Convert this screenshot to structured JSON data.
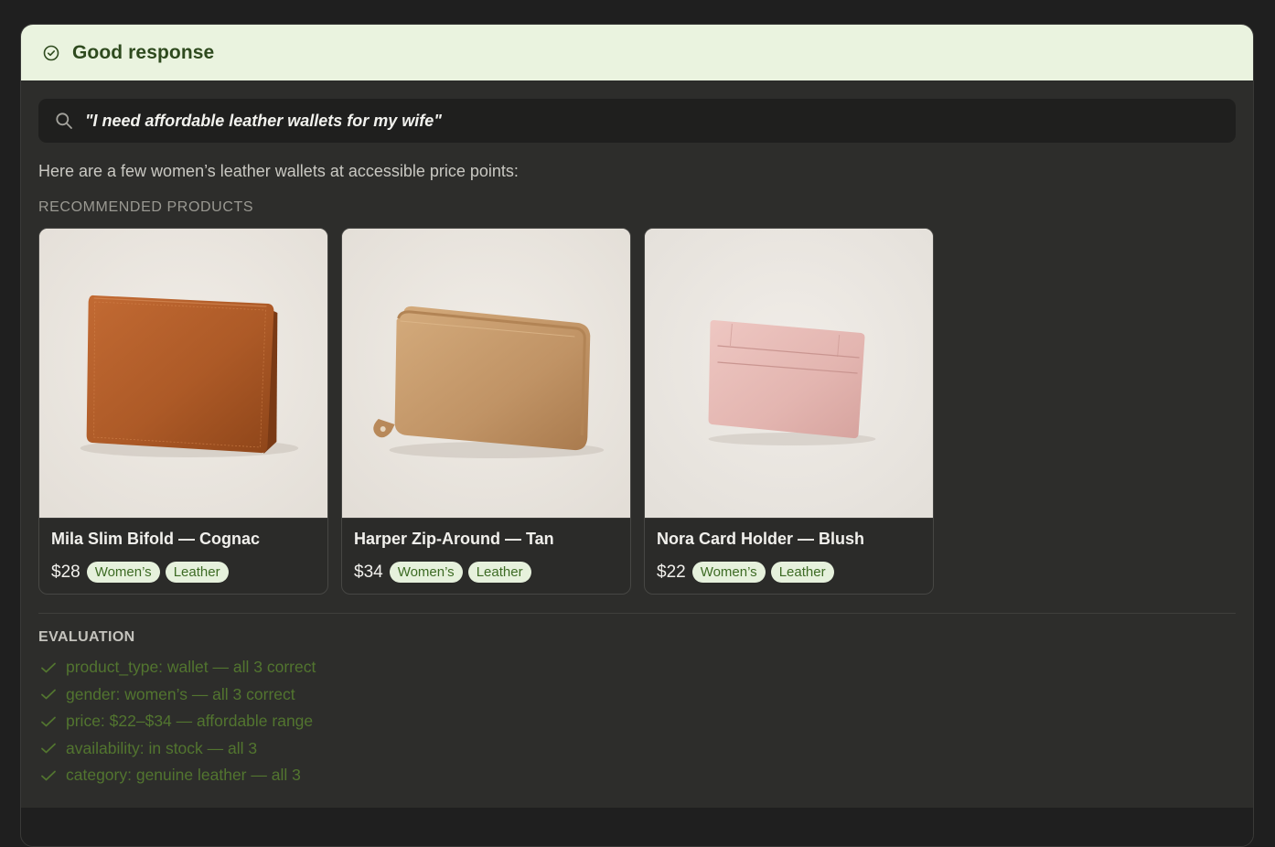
{
  "header": {
    "title": "Good response",
    "icon": "check-circle-icon"
  },
  "search": {
    "query": "\"I need affordable leather wallets for my wife\"",
    "icon": "search-icon"
  },
  "intro_text": "Here are a few women’s leather wallets at accessible price points:",
  "recommended_label": "RECOMMENDED PRODUCTS",
  "products": [
    {
      "title": "Mila Slim Bifold — Cognac",
      "price": "$28",
      "tags": [
        "Women’s",
        "Leather"
      ],
      "image": "cognac-bifold-wallet-photo"
    },
    {
      "title": "Harper Zip-Around — Tan",
      "price": "$34",
      "tags": [
        "Women’s",
        "Leather"
      ],
      "image": "tan-zip-around-wallet-photo"
    },
    {
      "title": "Nora Card Holder — Blush",
      "price": "$22",
      "tags": [
        "Women’s",
        "Leather"
      ],
      "image": "blush-card-holder-photo"
    }
  ],
  "evaluation": {
    "label": "EVALUATION",
    "items": [
      "product_type: wallet — all 3 correct",
      "gender: women’s — all 3 correct",
      "price: $22–$34 — affordable range",
      "availability: in stock — all 3",
      "category: genuine leather — all 3"
    ]
  },
  "colors": {
    "header_bg": "#eaf3df",
    "header_text": "#2e4a1e",
    "tag_bg": "#e6f1dc",
    "tag_text": "#3d6b24",
    "eval_text": "#52752f",
    "panel_bg": "#2d2d2b"
  }
}
